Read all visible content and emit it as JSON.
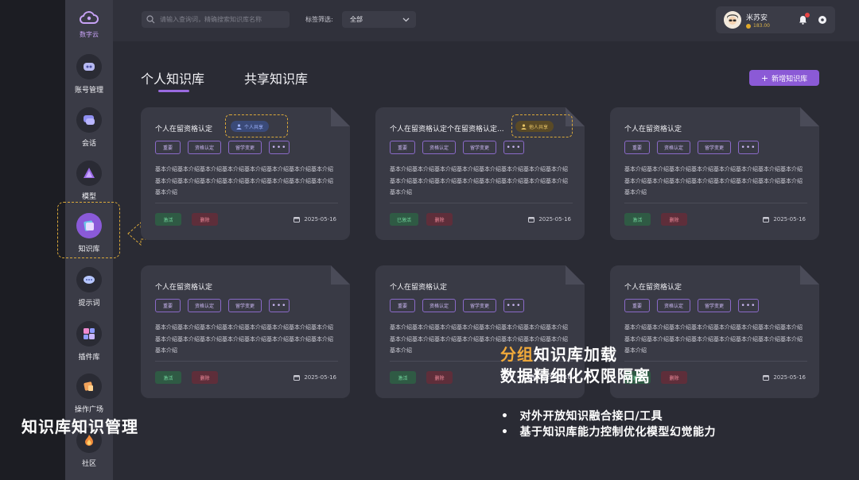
{
  "colors": {
    "accent": "#8b5ad6",
    "highlight": "#d9a83a",
    "activate": "#6fd39a",
    "delete": "#f08a9a",
    "heading_accent": "#f0a93a"
  },
  "sidebar": {
    "logo_text": "数字云",
    "items": [
      {
        "label": "账号管理",
        "icon": "account-icon"
      },
      {
        "label": "会话",
        "icon": "chat-icon"
      },
      {
        "label": "模型",
        "icon": "model-icon"
      },
      {
        "label": "知识库",
        "icon": "knowledge-icon",
        "active": true
      },
      {
        "label": "提示词",
        "icon": "prompt-icon"
      },
      {
        "label": "插件库",
        "icon": "plugin-icon"
      },
      {
        "label": "操作广场",
        "icon": "plaza-icon"
      },
      {
        "label": "社区",
        "icon": "community-icon"
      }
    ]
  },
  "topbar": {
    "search_placeholder": "请输入查询词，精确搜索知识库名称",
    "filter_label": "标签筛选:",
    "filter_value": "全部",
    "user": {
      "name": "米苏安",
      "points": "183.00"
    }
  },
  "tabs": [
    "个人知识库",
    "共享知识库"
  ],
  "add_button": "新增知识库",
  "cards": [
    {
      "title": "个人在留资格认定",
      "share": "个人共享",
      "tags": [
        "重要",
        "资格认定",
        "留学变更"
      ],
      "more": "•••",
      "desc": "基本介绍基本介绍基本介绍基本介绍基本介绍基本介绍基本介绍基本介绍基本介绍基本介绍基本介绍基本介绍基本介绍基本介绍基本介绍基本介绍基本介绍",
      "status": "激活",
      "delete": "删除",
      "date": "2025-05-16"
    },
    {
      "title": "个人在留资格认定个在留资格认定...",
      "share": "他人共享",
      "tags": [
        "重要",
        "资格认定",
        "留学变更"
      ],
      "more": "•••",
      "desc": "基本介绍基本介绍基本介绍基本介绍基本介绍基本介绍基本介绍基本介绍基本介绍基本介绍基本介绍基本介绍基本介绍基本介绍基本介绍基本介绍基本介绍",
      "status": "已激活",
      "delete": "删除",
      "date": "2025-05-16"
    },
    {
      "title": "个人在留资格认定",
      "share": "",
      "tags": [
        "重要",
        "资格认定",
        "留学变更"
      ],
      "more": "•••",
      "desc": "基本介绍基本介绍基本介绍基本介绍基本介绍基本介绍基本介绍基本介绍基本介绍基本介绍基本介绍基本介绍基本介绍基本介绍基本介绍基本介绍基本介绍",
      "status": "激活",
      "delete": "删除",
      "date": "2025-05-16"
    },
    {
      "title": "个人在留资格认定",
      "share": "",
      "tags": [
        "重要",
        "资格认定",
        "留学变更"
      ],
      "more": "•••",
      "desc": "基本介绍基本介绍基本介绍基本介绍基本介绍基本介绍基本介绍基本介绍基本介绍基本介绍基本介绍基本介绍基本介绍基本介绍基本介绍基本介绍基本介绍",
      "status": "激活",
      "delete": "删除",
      "date": "2025-05-16"
    },
    {
      "title": "个人在留资格认定",
      "share": "",
      "tags": [
        "重要",
        "资格认定",
        "留学变更"
      ],
      "more": "•••",
      "desc": "基本介绍基本介绍基本介绍基本介绍基本介绍基本介绍基本介绍基本介绍基本介绍基本介绍基本介绍基本介绍基本介绍基本介绍基本介绍基本介绍基本介绍",
      "status": "激活",
      "delete": "删除",
      "date": "2025-05-16"
    },
    {
      "title": "个人在留资格认定",
      "share": "",
      "tags": [
        "重要",
        "资格认定",
        "留学变更"
      ],
      "more": "•••",
      "desc": "基本介绍基本介绍基本介绍基本介绍基本介绍基本介绍基本介绍基本介绍基本介绍基本介绍基本介绍基本介绍基本介绍基本介绍基本介绍基本介绍基本介绍",
      "status": "激活",
      "delete": "删除",
      "date": "2025-05-16"
    }
  ],
  "overlay": {
    "left_caption": "知识库知识管理",
    "heading_accent": "分组",
    "heading_line1_rest": "知识库加载",
    "heading_line2": "数据精细化权限隔离",
    "bullets": [
      "对外开放知识融合接口/工具",
      "基于知识库能力控制优化模型幻觉能力"
    ],
    "bullet_mark": "•"
  }
}
